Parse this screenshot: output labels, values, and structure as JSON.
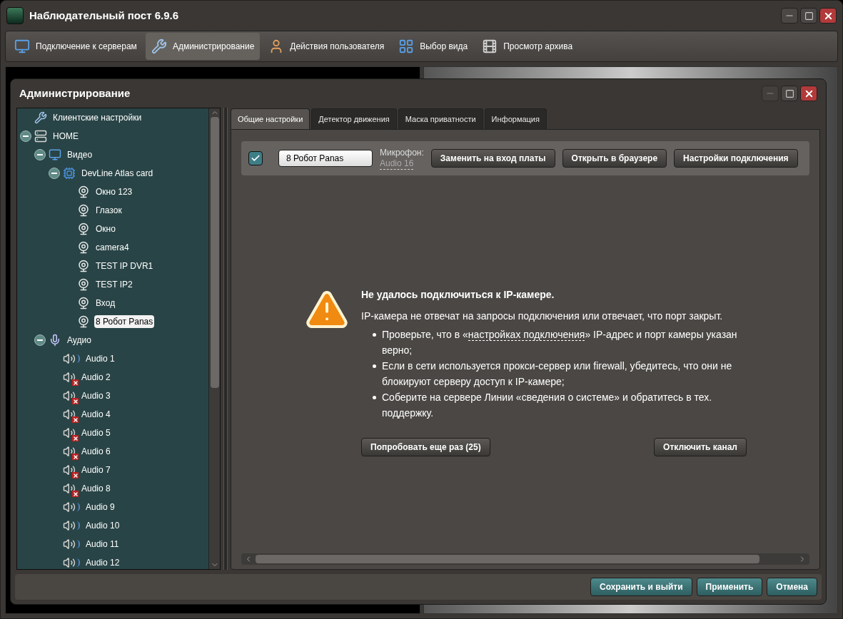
{
  "window": {
    "title": "Наблюдательный пост 6.9.6"
  },
  "toolbar": [
    {
      "label": "Подключение к серверам",
      "selected": false
    },
    {
      "label": "Администрирование",
      "selected": true
    },
    {
      "label": "Действия пользователя",
      "selected": false
    },
    {
      "label": "Выбор вида",
      "selected": false
    },
    {
      "label": "Просмотр архива",
      "selected": false
    }
  ],
  "dialog": {
    "title": "Администрирование",
    "tree": [
      {
        "label": "Клиентские настройки",
        "kind": "tools",
        "selected": false
      },
      {
        "label": "HOME",
        "kind": "server",
        "selected": false,
        "expanded": true,
        "children": [
          {
            "label": "Видео",
            "kind": "monitor",
            "selected": false,
            "expanded": true,
            "children": [
              {
                "label": "DevLine Atlas card",
                "kind": "card",
                "selected": false,
                "expanded": true,
                "children": [
                  {
                    "label": "Окно 123",
                    "kind": "camera",
                    "selected": false
                  },
                  {
                    "label": "Глазок",
                    "kind": "camera",
                    "selected": false
                  },
                  {
                    "label": "Окно",
                    "kind": "camera",
                    "selected": false
                  },
                  {
                    "label": "camera4",
                    "kind": "camera",
                    "selected": false
                  },
                  {
                    "label": "TEST IP DVR1",
                    "kind": "camera",
                    "selected": false
                  },
                  {
                    "label": "TEST IP2",
                    "kind": "camera",
                    "selected": false
                  },
                  {
                    "label": "Вход",
                    "kind": "camera",
                    "selected": false
                  },
                  {
                    "label": "8 Робот Panas",
                    "kind": "camera",
                    "selected": true
                  }
                ]
              }
            ]
          },
          {
            "label": "Аудио",
            "kind": "mic",
            "selected": false,
            "expanded": true,
            "children": [
              {
                "label": "Audio 1",
                "kind": "audio",
                "selected": false,
                "error": false
              },
              {
                "label": "Audio 2",
                "kind": "audio",
                "selected": false,
                "error": true
              },
              {
                "label": "Audio 3",
                "kind": "audio",
                "selected": false,
                "error": true
              },
              {
                "label": "Audio 4",
                "kind": "audio",
                "selected": false,
                "error": true
              },
              {
                "label": "Audio 5",
                "kind": "audio",
                "selected": false,
                "error": true
              },
              {
                "label": "Audio 6",
                "kind": "audio",
                "selected": false,
                "error": true
              },
              {
                "label": "Audio 7",
                "kind": "audio",
                "selected": false,
                "error": true
              },
              {
                "label": "Audio 8",
                "kind": "audio",
                "selected": false,
                "error": true
              },
              {
                "label": "Audio 9",
                "kind": "audio",
                "selected": false,
                "error": false
              },
              {
                "label": "Audio 10",
                "kind": "audio",
                "selected": false,
                "error": false
              },
              {
                "label": "Audio 11",
                "kind": "audio",
                "selected": false,
                "error": false
              },
              {
                "label": "Audio 12",
                "kind": "audio",
                "selected": false,
                "error": false
              }
            ]
          }
        ]
      }
    ],
    "tabs": [
      {
        "label": "Общие настройки",
        "selected": true
      },
      {
        "label": "Детектор движения",
        "selected": false
      },
      {
        "label": "Маска приватности",
        "selected": false
      },
      {
        "label": "Информация",
        "selected": false
      }
    ],
    "channel": {
      "enabled": true,
      "name": "8 Робот Panas",
      "mic_label": "Микрофон:",
      "mic_value": "Audio 16",
      "buttons": [
        "Заменить на вход платы",
        "Открыть в браузере",
        "Настройки подключения"
      ]
    },
    "message": {
      "title": "Не удалось подключиться к IP-камере.",
      "text": "IP-камера не отвечат на запросы подключения или отвечает, что порт закрыт.",
      "bullets": [
        {
          "before": "Проверьте, что в «",
          "link": "настройках подключения",
          "after": "» IP-адрес и порт камеры указан верно;"
        },
        {
          "before": "Если в сети используется прокси-сервер или firewall, убедитесь, что они не блокируют серверу доступ к IP-камере;"
        },
        {
          "before": "Соберите на сервере Линии «сведения о системе» и обратитесь в тех. поддержку."
        }
      ],
      "retry_button": "Попробовать еще раз (25)",
      "disable_button": "Отключить канал"
    },
    "footer_buttons": [
      "Сохранить и выйти",
      "Применить",
      "Отмена"
    ]
  }
}
